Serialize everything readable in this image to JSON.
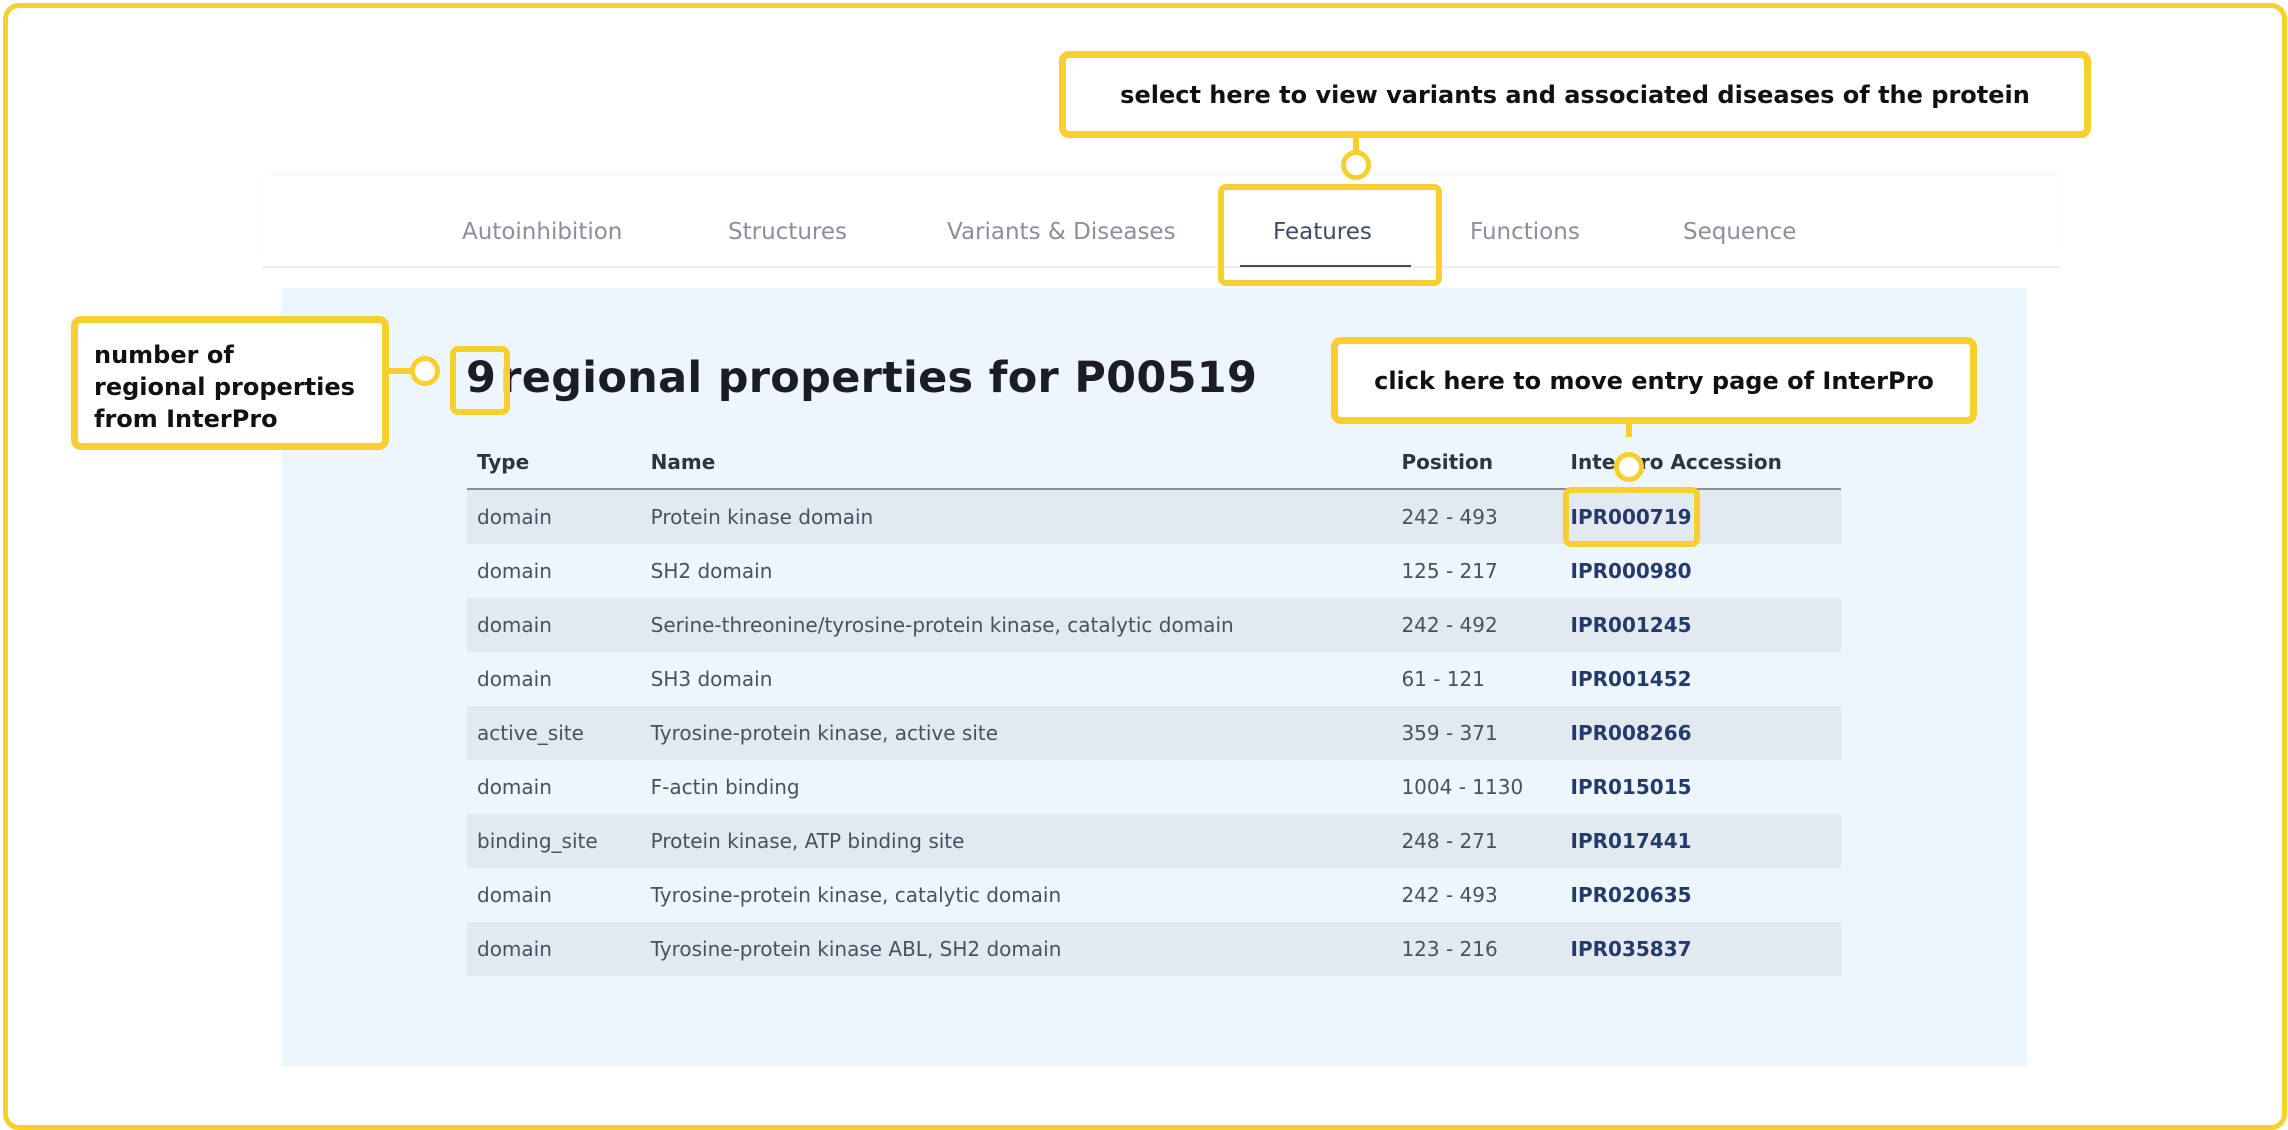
{
  "tabs": [
    {
      "label": "Autoinhibition"
    },
    {
      "label": "Structures"
    },
    {
      "label": "Variants & Diseases"
    },
    {
      "label": "Features"
    },
    {
      "label": "Functions"
    },
    {
      "label": "Sequence"
    }
  ],
  "active_tab": "Features",
  "heading": {
    "count": "9",
    "text": "regional properties for P00519"
  },
  "table": {
    "headers": [
      "Type",
      "Name",
      "Position",
      "InterPro Accession"
    ],
    "rows": [
      {
        "type": "domain",
        "name": "Protein kinase domain",
        "position": "242 - 493",
        "accession": "IPR000719"
      },
      {
        "type": "domain",
        "name": "SH2 domain",
        "position": "125 - 217",
        "accession": "IPR000980"
      },
      {
        "type": "domain",
        "name": "Serine-threonine/tyrosine-protein kinase, catalytic domain",
        "position": "242 - 492",
        "accession": "IPR001245"
      },
      {
        "type": "domain",
        "name": "SH3 domain",
        "position": "61 - 121",
        "accession": "IPR001452"
      },
      {
        "type": "active_site",
        "name": "Tyrosine-protein kinase, active site",
        "position": "359 - 371",
        "accession": "IPR008266"
      },
      {
        "type": "domain",
        "name": "F-actin binding",
        "position": "1004 - 1130",
        "accession": "IPR015015"
      },
      {
        "type": "binding_site",
        "name": "Protein kinase, ATP binding site",
        "position": "248 - 271",
        "accession": "IPR017441"
      },
      {
        "type": "domain",
        "name": "Tyrosine-protein kinase, catalytic domain",
        "position": "242 - 493",
        "accession": "IPR020635"
      },
      {
        "type": "domain",
        "name": "Tyrosine-protein kinase ABL, SH2 domain",
        "position": "123 - 216",
        "accession": "IPR035837"
      }
    ]
  },
  "annotations": {
    "tab_callout": "select here to view variants and associated diseases of the protein",
    "count_callout": [
      "number of",
      "regional properties",
      "from InterPro"
    ],
    "accession_callout": "click here to move entry page of InterPro"
  },
  "colors": {
    "highlight": "#f7cf2f",
    "panel_bg": "#eef6fd",
    "stripe": "#e2e9f1",
    "link": "#243a6b",
    "active_tab": "#3f4a66"
  }
}
